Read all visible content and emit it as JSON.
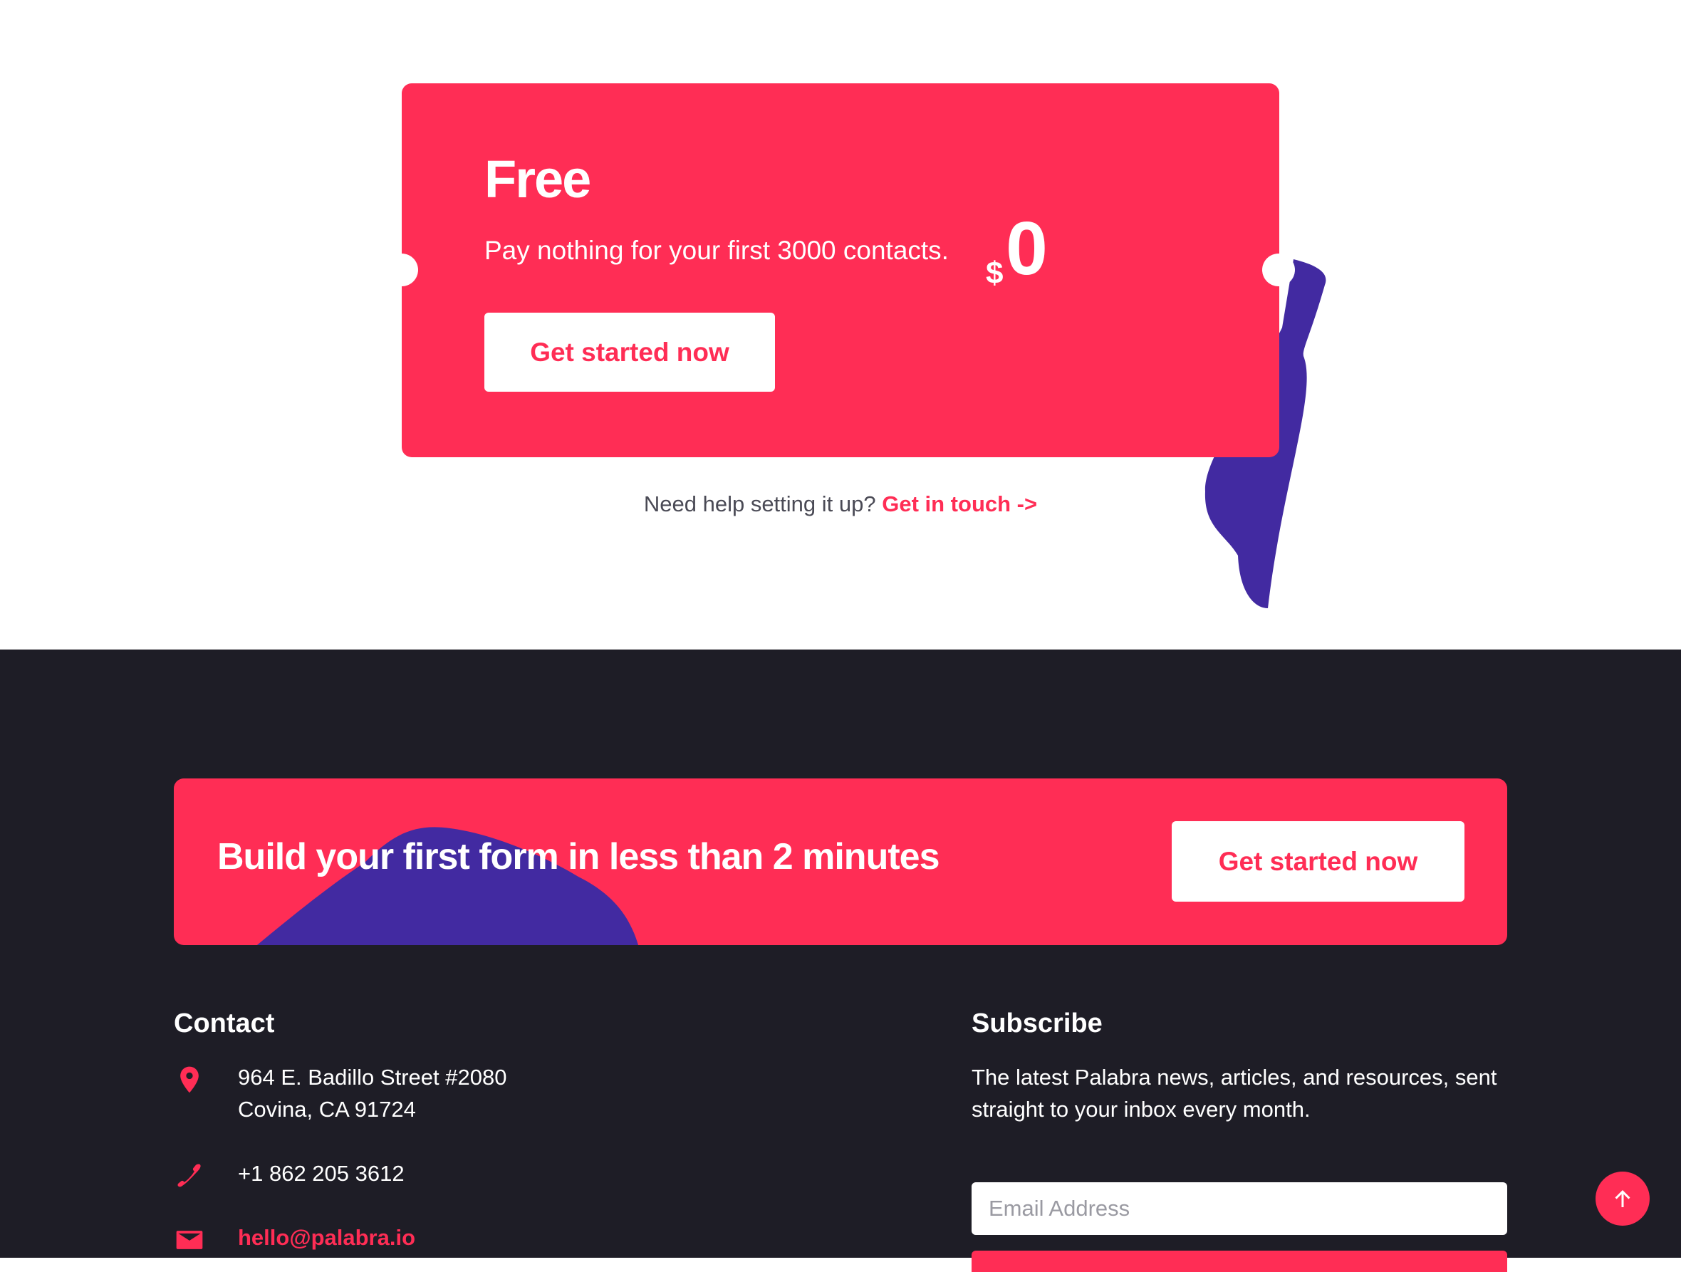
{
  "pricing": {
    "plan_name": "Free",
    "description": "Pay nothing for your first 3000 contacts.",
    "currency": "$",
    "amount": "0",
    "button_label": "Get started now"
  },
  "help": {
    "text": "Need help setting it up?",
    "link_label": "Get in touch ->"
  },
  "cta": {
    "title": "Build your first form in less than 2 minutes",
    "button_label": "Get started now"
  },
  "contact": {
    "title": "Contact",
    "address_line1": "964 E. Badillo Street #2080",
    "address_line2": "Covina, CA 91724",
    "phone": "+1 862 205 3612",
    "email": "hello@palabra.io"
  },
  "subscribe": {
    "title": "Subscribe",
    "text": "The latest Palabra news, articles, and resources, sent straight to your inbox every month.",
    "email_placeholder": "Email Address"
  },
  "icons": {
    "address": "location-pin-icon",
    "phone": "phone-icon",
    "email": "mail-icon",
    "scroll_top": "arrow-up-icon"
  },
  "colors": {
    "accent": "#ff2d55",
    "blob": "#422aa1",
    "footer_bg": "#1e1d26"
  }
}
